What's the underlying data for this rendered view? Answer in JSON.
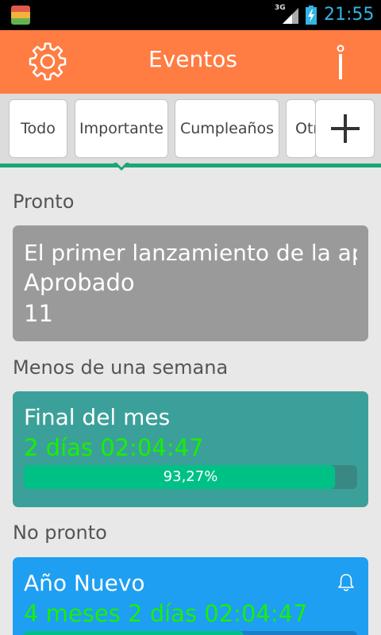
{
  "status_bar": {
    "network": "3G",
    "time": "21:55"
  },
  "app_bar": {
    "title": "Eventos",
    "settings_icon": "gear-icon",
    "info_icon": "info-icon"
  },
  "tabs": [
    {
      "label": "Todo"
    },
    {
      "label": "Importante"
    },
    {
      "label": "Cumpleaños"
    },
    {
      "label": "Otros"
    }
  ],
  "add_button_icon": "plus-icon",
  "sections": [
    {
      "header": "Pronto",
      "card": {
        "title": "El primer lanzamiento de la aplicación",
        "line2": "Aprobado",
        "line3": "11",
        "color": "#9b9a9a"
      }
    },
    {
      "header": "Menos de una semana",
      "card": {
        "title": "Final del mes",
        "countdown": "2 días 02:04:47",
        "progress_text": "93,27%",
        "progress_fraction": 0.9327,
        "color": "#3ca09a",
        "bar_color": "#00c185",
        "track_color": "#3a8884"
      }
    },
    {
      "header": "No pronto",
      "card": {
        "title": "Año Nuevo",
        "countdown": "4 meses 2 días 02:04:47",
        "icon": "bell-icon",
        "color": "#1e9ff2",
        "bar_color": "#00c185",
        "track_color": "#1a7fc7"
      }
    }
  ]
}
